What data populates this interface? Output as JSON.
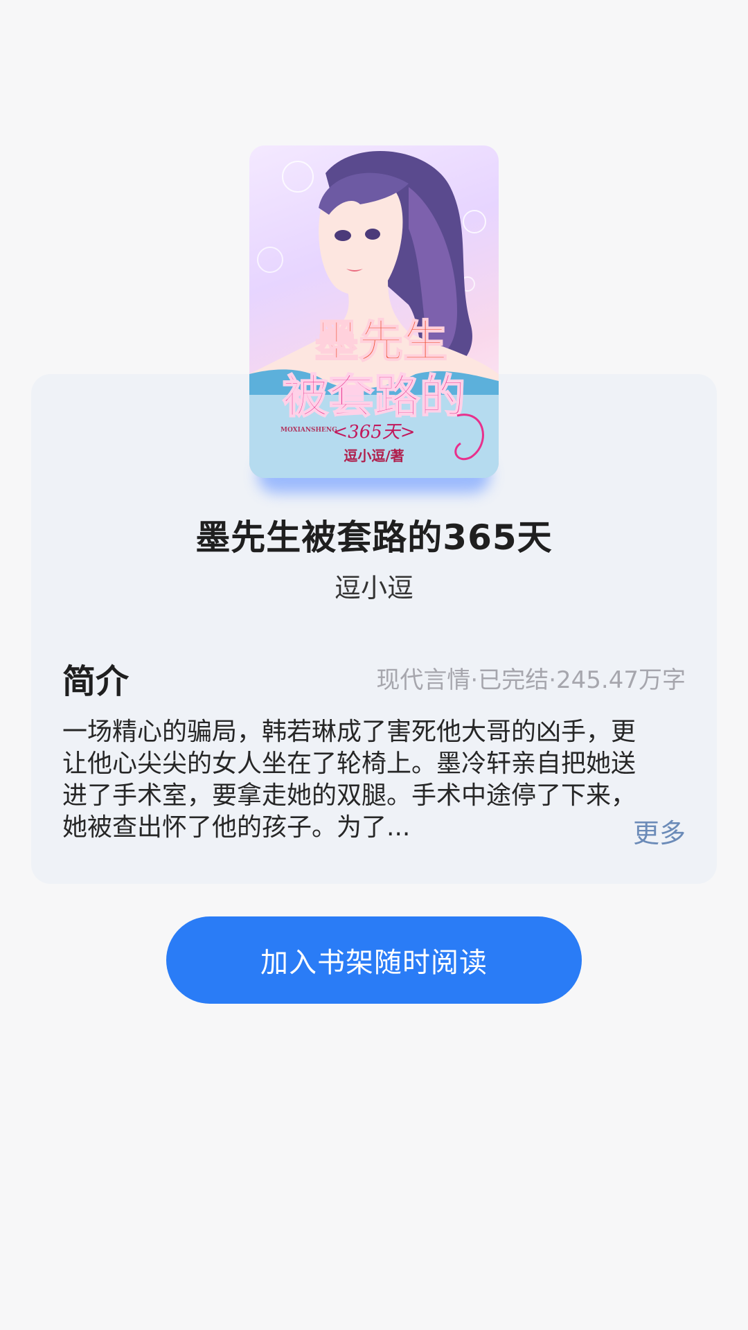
{
  "book": {
    "title": "墨先生被套路的365天",
    "author": "逗小逗",
    "cover": {
      "title_line1": "墨先生",
      "title_line2": "被套路的",
      "subtitle": "<365天>",
      "pinyin": "MOXIANSHENG",
      "byline": "逗小逗/著"
    }
  },
  "intro": {
    "heading": "简介",
    "meta": "现代言情·已完结·245.47万字",
    "lines": [
      "一场精心的骗局，韩若琳成了害死他大哥的凶手，更",
      "让他心尖尖的女人坐在了轮椅上。墨冷轩亲自把她送",
      "进了手术室，要拿走她的双腿。手术中途停了下来，",
      "她被查出怀了他的孩子。为了..."
    ],
    "more_label": "更多"
  },
  "actions": {
    "add_to_shelf_label": "加入书架随时阅读"
  },
  "colors": {
    "accent": "#2a7cf6",
    "card_bg": "#eff2f7",
    "page_bg": "#f7f7f8",
    "meta": "#a6a6ad",
    "more": "#6b8bb8"
  }
}
